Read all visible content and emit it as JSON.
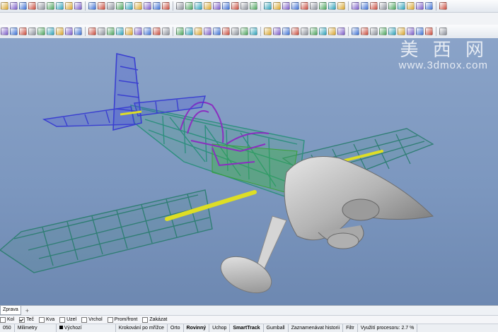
{
  "watermark": {
    "brand": "美 西 网",
    "url": "www.3dmox.com"
  },
  "viewport": {
    "tab": "Zprava",
    "add_tab": "+"
  },
  "osnaps": [
    {
      "label": "Kol",
      "checked": false
    },
    {
      "label": "Teč",
      "checked": true
    },
    {
      "label": "Kva",
      "checked": false
    },
    {
      "label": "Uzel",
      "checked": false
    },
    {
      "label": "Vrchol",
      "checked": false
    },
    {
      "label": "Prom/front",
      "checked": false
    },
    {
      "label": "Zakázat",
      "checked": false
    }
  ],
  "status": {
    "coord": "050",
    "units": "Milimetry",
    "layer": "Výchozí",
    "grid_snap": "Krokování po mřížce",
    "ortho": "Orto",
    "planar": "Rovinný",
    "osnap": "Uchop",
    "smarttrack": "SmartTrack",
    "gumball": "Gumball",
    "history": "Zaznamenávat historii",
    "filter": "Filtr",
    "cpu": "Využití procesoru: 2.7 %"
  },
  "colors": {
    "viewport_bg": "#7c97bf",
    "fuselage": "#3f9e8c",
    "tail": "#3a3fd0",
    "canopy": "#8a2fc0",
    "spar": "#e0e02a",
    "cowl": "#b8b8b8"
  }
}
